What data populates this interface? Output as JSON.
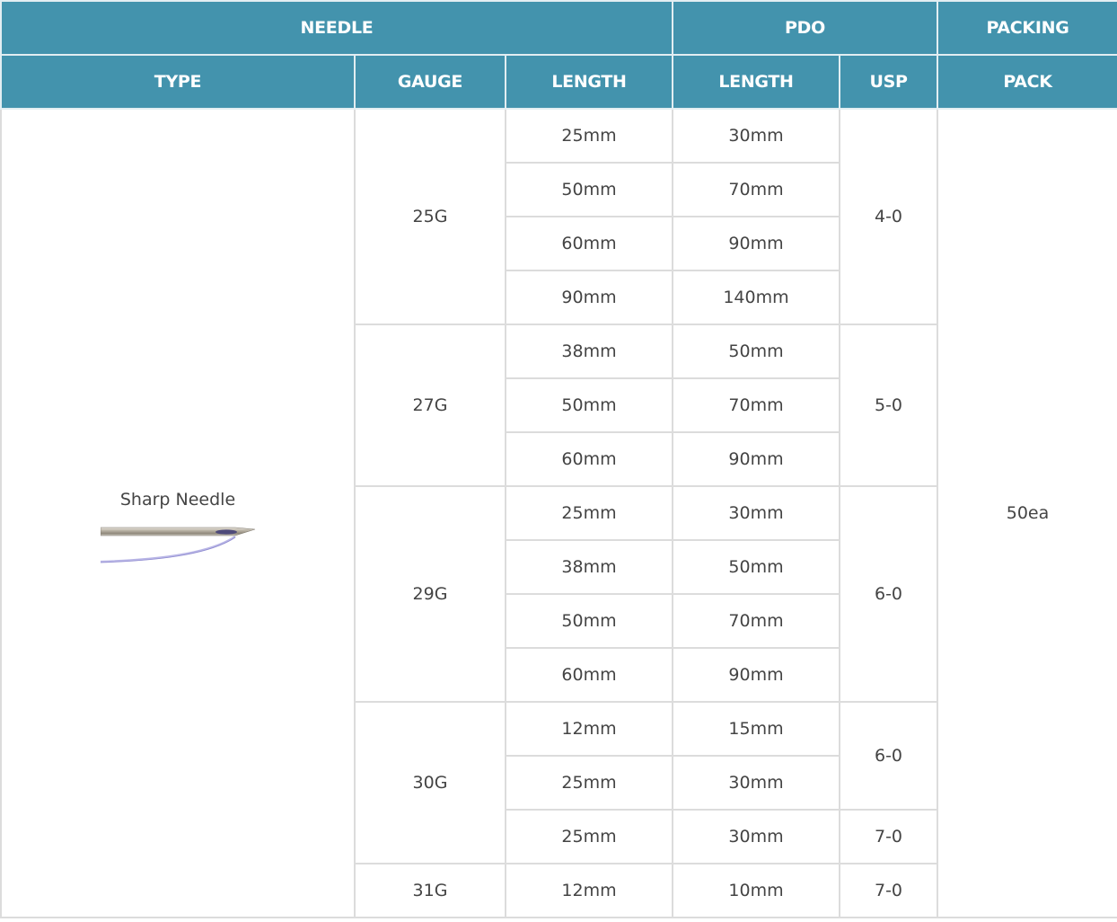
{
  "header": {
    "groups": {
      "needle": "NEEDLE",
      "pdo": "PDO",
      "packing": "PACKING"
    },
    "columns": {
      "type": "TYPE",
      "gauge": "GAUGE",
      "needle_length": "LENGTH",
      "pdo_length": "LENGTH",
      "usp": "USP",
      "pack": "PACK"
    }
  },
  "body": {
    "type_label": "Sharp Needle",
    "pack": "50ea",
    "g25": {
      "gauge": "25G",
      "usp": "4-0",
      "rows": [
        {
          "needle": "25mm",
          "pdo": "30mm"
        },
        {
          "needle": "50mm",
          "pdo": "70mm"
        },
        {
          "needle": "60mm",
          "pdo": "90mm"
        },
        {
          "needle": "90mm",
          "pdo": "140mm"
        }
      ]
    },
    "g27": {
      "gauge": "27G",
      "usp": "5-0",
      "rows": [
        {
          "needle": "38mm",
          "pdo": "50mm"
        },
        {
          "needle": "50mm",
          "pdo": "70mm"
        },
        {
          "needle": "60mm",
          "pdo": "90mm"
        }
      ]
    },
    "g29": {
      "gauge": "29G",
      "usp": "6-0",
      "rows": [
        {
          "needle": "25mm",
          "pdo": "30mm"
        },
        {
          "needle": "38mm",
          "pdo": "50mm"
        },
        {
          "needle": "50mm",
          "pdo": "70mm"
        },
        {
          "needle": "60mm",
          "pdo": "90mm"
        }
      ]
    },
    "g30": {
      "gauge": "30G",
      "usp_a": "6-0",
      "usp_b": "7-0",
      "rows": [
        {
          "needle": "12mm",
          "pdo": "15mm"
        },
        {
          "needle": "25mm",
          "pdo": "30mm"
        },
        {
          "needle": "25mm",
          "pdo": "30mm"
        }
      ]
    },
    "g31": {
      "gauge": "31G",
      "usp": "7-0",
      "rows": [
        {
          "needle": "12mm",
          "pdo": "10mm"
        }
      ]
    }
  }
}
